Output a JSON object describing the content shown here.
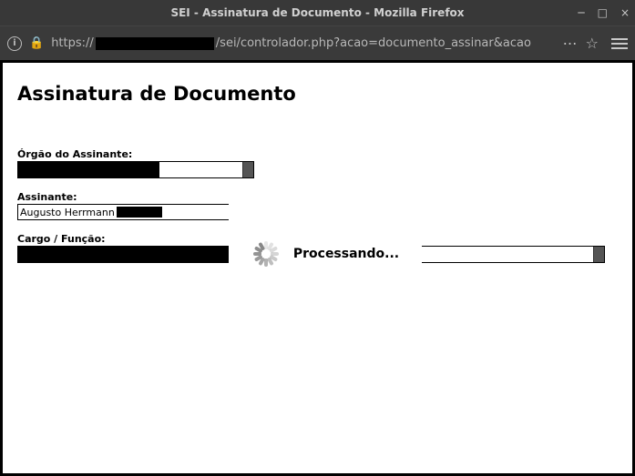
{
  "window": {
    "title": "SEI - Assinatura de Documento - Mozilla Firefox"
  },
  "urlbar": {
    "prefix": "https://",
    "suffix": "/sei/controlador.php?acao=documento_assinar&acao"
  },
  "page": {
    "heading": "Assinatura de Documento",
    "orgao_label": "Órgão do Assinante:",
    "assinante_label": "Assinante:",
    "assinante_value_visible": "Augusto Herrmann",
    "cargo_label": "Cargo / Função:"
  },
  "overlay": {
    "message": "Processando..."
  }
}
